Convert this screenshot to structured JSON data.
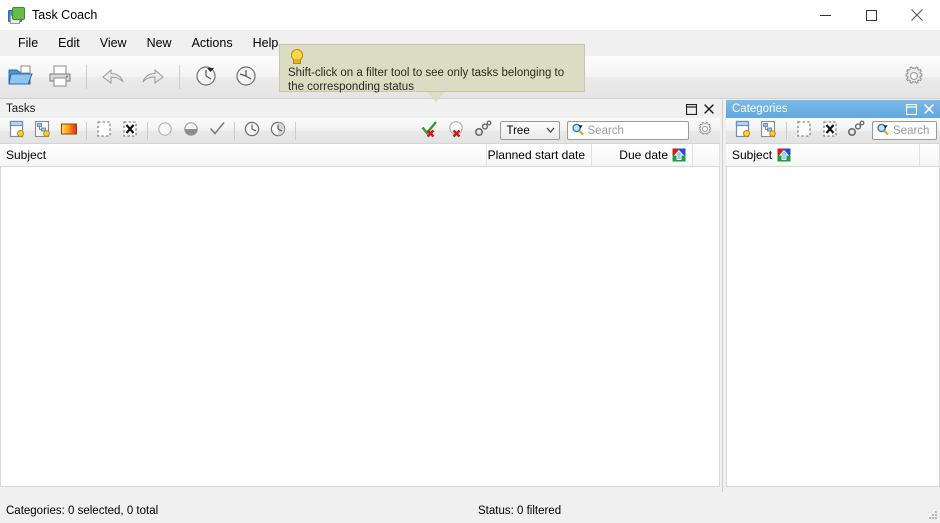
{
  "window": {
    "title": "Task Coach",
    "app_icon": "task-coach-icon",
    "controls": {
      "minimize": "minimize-icon",
      "maximize": "maximize-icon",
      "close": "close-icon"
    }
  },
  "menubar": {
    "items": [
      {
        "label": "File"
      },
      {
        "label": "Edit"
      },
      {
        "label": "View"
      },
      {
        "label": "New"
      },
      {
        "label": "Actions"
      },
      {
        "label": "Help"
      }
    ]
  },
  "main_toolbar": {
    "buttons": [
      {
        "name": "open-file-button",
        "icon": "open-folder-icon"
      },
      {
        "name": "print-button",
        "icon": "printer-icon"
      },
      {
        "name": "undo-button",
        "icon": "undo-arrow-icon"
      },
      {
        "name": "redo-button",
        "icon": "redo-arrow-icon"
      },
      {
        "name": "start-tracking-button",
        "icon": "clock-dropdown-icon"
      },
      {
        "name": "stop-tracking-button",
        "icon": "clock-icon"
      }
    ],
    "settings": {
      "name": "preferences-button",
      "icon": "gear-icon"
    }
  },
  "tooltip": {
    "icon": "lightbulb-icon",
    "text": "Shift-click on a filter tool to see only tasks belonging to the corresponding status"
  },
  "tasks_panel": {
    "caption": "Tasks",
    "active": false,
    "caption_buttons": {
      "float": "restore-icon",
      "close": "close-icon"
    },
    "toolbar": {
      "buttons": [
        {
          "name": "new-task-button",
          "icon": "new-task-icon"
        },
        {
          "name": "new-subtask-button",
          "icon": "new-subtask-icon"
        },
        {
          "name": "edit-task-button",
          "icon": "edit-task-icon"
        },
        {
          "name": "mark-inactive-button",
          "icon": "dotted-square-icon"
        },
        {
          "name": "delete-task-button",
          "icon": "delete-x-icon"
        },
        {
          "name": "filter-inactive-button",
          "icon": "empty-circle-icon"
        },
        {
          "name": "filter-active-button",
          "icon": "half-circle-icon"
        },
        {
          "name": "filter-completed-button",
          "icon": "checkmark-icon"
        },
        {
          "name": "filter-overdue-button",
          "icon": "clock-overdue-icon"
        },
        {
          "name": "filter-duesoon-button",
          "icon": "clock-globe-icon"
        },
        {
          "name": "mark-complete-button",
          "icon": "green-check-red-x-icon"
        },
        {
          "name": "mark-incomplete-button",
          "icon": "red-circle-x-icon"
        },
        {
          "name": "task-dependencies-button",
          "icon": "chain-link-icon"
        }
      ],
      "view_mode": {
        "value": "Tree",
        "chevron": "chevron-down-icon"
      },
      "search": {
        "placeholder": "Search",
        "value": "",
        "icon": "search-magnifier-icon"
      },
      "settings": {
        "name": "task-viewer-settings-button",
        "icon": "gear-icon"
      }
    },
    "columns": [
      {
        "label": "Subject",
        "align": "left",
        "sorted": false
      },
      {
        "label": "Planned start date",
        "align": "right",
        "sorted": false
      },
      {
        "label": "Due date",
        "align": "right",
        "sorted": true,
        "sort_icon": "sort-ascending-icon"
      },
      {
        "label": "",
        "align": "left",
        "sorted": false
      }
    ],
    "rows": []
  },
  "categories_panel": {
    "caption": "Categories",
    "active": true,
    "caption_buttons": {
      "float": "restore-icon",
      "close": "close-icon"
    },
    "toolbar": {
      "buttons": [
        {
          "name": "new-category-button",
          "icon": "new-category-icon"
        },
        {
          "name": "new-subcategory-button",
          "icon": "new-subcategory-icon"
        },
        {
          "name": "edit-category-button",
          "icon": "dotted-square-icon"
        },
        {
          "name": "delete-category-button",
          "icon": "delete-x-icon"
        },
        {
          "name": "category-links-button",
          "icon": "chain-link-icon"
        }
      ],
      "search": {
        "placeholder": "Search",
        "value": "",
        "icon": "search-magnifier-icon"
      }
    },
    "columns": [
      {
        "label": "Subject",
        "align": "left",
        "sorted": true,
        "sort_icon": "sort-ascending-icon"
      },
      {
        "label": "",
        "align": "left",
        "sorted": false
      }
    ],
    "rows": []
  },
  "statusbar": {
    "left": "Categories: 0 selected, 0 total",
    "right": "Status: 0 filtered",
    "grip": "resize-grip-icon"
  }
}
